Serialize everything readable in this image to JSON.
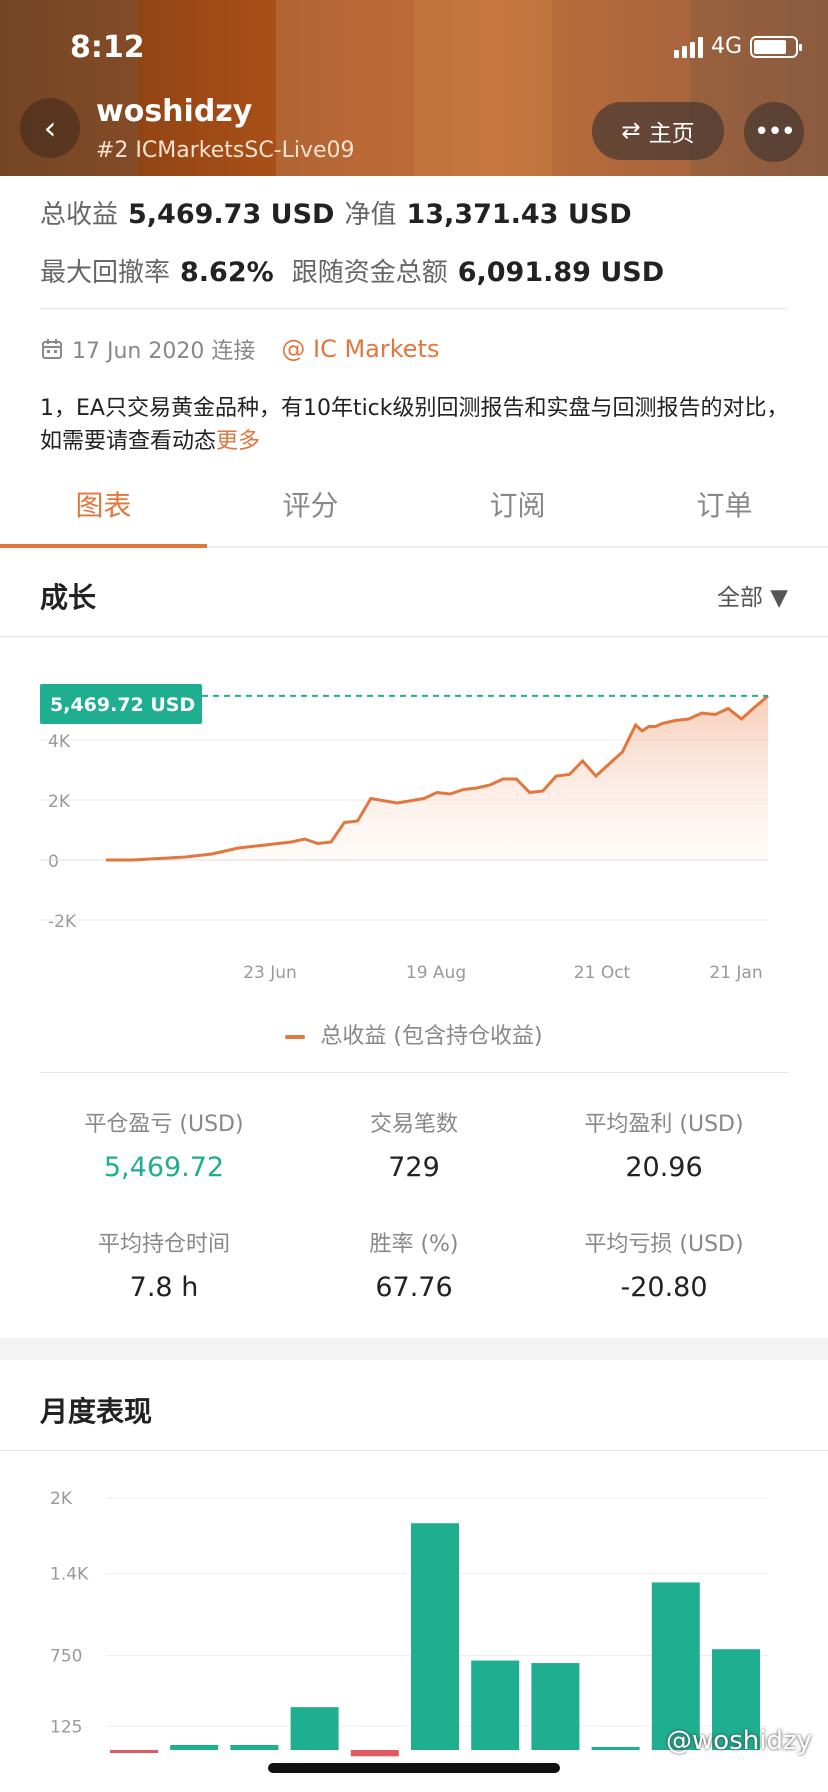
{
  "status": {
    "time": "8:12",
    "network": "4G"
  },
  "header": {
    "title": "woshidzy",
    "subtitle": "#2 ICMarketsSC-Live09",
    "home_label": "主页"
  },
  "stats": {
    "total_profit_label": "总收益",
    "total_profit_value": "5,469.73 USD",
    "equity_label": "净值",
    "equity_value": "13,371.43 USD",
    "drawdown_label": "最大回撤率",
    "drawdown_value": "8.62%",
    "follow_label": "跟随资金总额",
    "follow_value": "6,091.89 USD"
  },
  "meta": {
    "connect_date": "17 Jun 2020 连接",
    "broker": "IC Markets"
  },
  "description": {
    "text": "1，EA只交易黄金品种，有10年tick级别回测报告和实盘与回测报告的对比，如需要请查看动态",
    "more": "更多"
  },
  "tabs": [
    "图表",
    "评分",
    "订阅",
    "订单"
  ],
  "growth": {
    "title": "成长",
    "range": "全部",
    "current_badge": "5,469.72 USD",
    "legend": "总收益 (包含持仓收益)"
  },
  "metrics": [
    {
      "label": "平仓盈亏 (USD)",
      "value": "5,469.72"
    },
    {
      "label": "交易笔数",
      "value": "729"
    },
    {
      "label": "平均盈利 (USD)",
      "value": "20.96"
    },
    {
      "label": "平均持仓时间",
      "value": "7.8 h"
    },
    {
      "label": "胜率 (%)",
      "value": "67.76"
    },
    {
      "label": "平均亏损 (USD)",
      "value": "-20.80"
    }
  ],
  "monthly": {
    "title": "月度表现"
  },
  "watermark": "@woshidzy",
  "colors": {
    "accent": "#e1763e",
    "green": "#1fae8f",
    "red": "#e05a64"
  },
  "chart_data": [
    {
      "type": "area",
      "x_ticks": [
        "23 Jun",
        "19 Aug",
        "21 Oct",
        "21 Jan"
      ],
      "y_ticks": [
        "4K",
        "2K",
        "0",
        "-2K"
      ],
      "ylim": [
        -2000,
        6000
      ],
      "grid": true,
      "series": [
        {
          "name": "总收益 (包含持仓收益)",
          "x": [
            0,
            4,
            8,
            12,
            16,
            20,
            24,
            28,
            30,
            32,
            34,
            36,
            38,
            40,
            44,
            48,
            50,
            52,
            54,
            56,
            58,
            60,
            62,
            64,
            66,
            68,
            70,
            72,
            74,
            76,
            78,
            80,
            81,
            82,
            83,
            84,
            85,
            86,
            88,
            90,
            92,
            94,
            96,
            98,
            100
          ],
          "values": [
            0,
            0,
            50,
            100,
            200,
            400,
            500,
            600,
            700,
            550,
            600,
            1250,
            1300,
            2050,
            1900,
            2050,
            2250,
            2200,
            2350,
            2400,
            2500,
            2700,
            2700,
            2250,
            2300,
            2800,
            2850,
            3300,
            2800,
            3200,
            3600,
            4500,
            4300,
            4450,
            4450,
            4550,
            4600,
            4650,
            4700,
            4900,
            4850,
            5050,
            4700,
            5100,
            5469.72
          ]
        }
      ]
    },
    {
      "type": "bar",
      "y_ticks": [
        "2K",
        "1.4K",
        "750",
        "125"
      ],
      "ylim": [
        0,
        2000
      ],
      "values": [
        -20,
        40,
        40,
        340,
        -50,
        1800,
        710,
        690,
        10,
        1330,
        800
      ]
    }
  ]
}
